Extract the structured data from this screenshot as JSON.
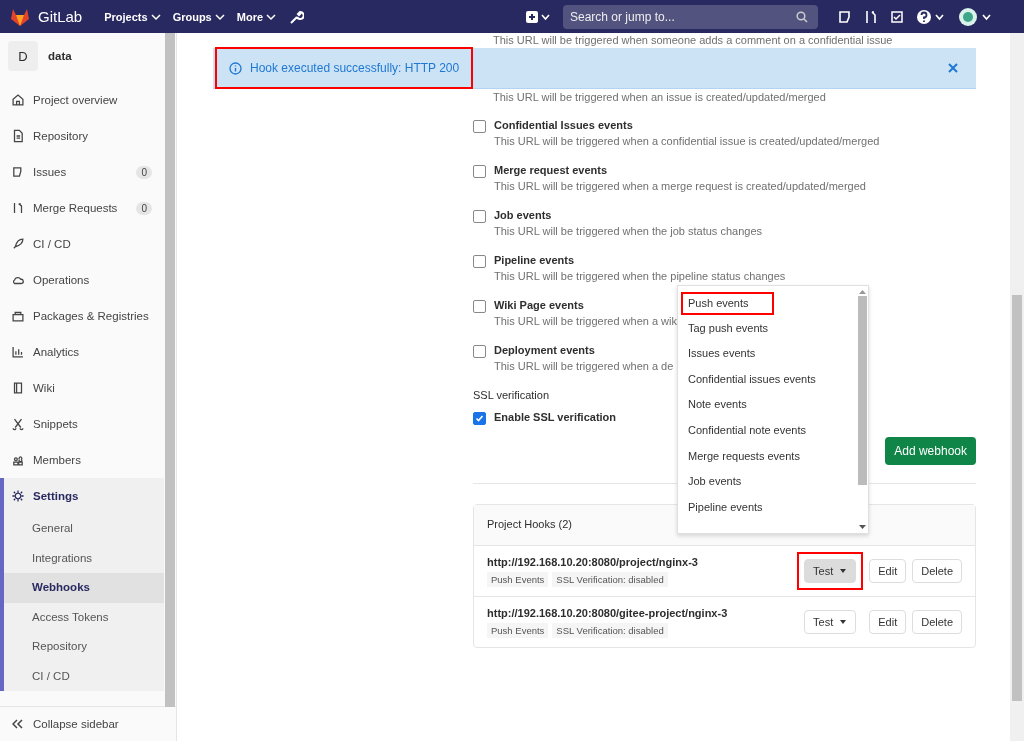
{
  "navbar": {
    "brand": "GitLab",
    "menus": [
      {
        "label": "Projects"
      },
      {
        "label": "Groups"
      },
      {
        "label": "More"
      }
    ],
    "search": {
      "placeholder": "Search or jump to..."
    }
  },
  "sidebar": {
    "project_initial": "D",
    "project_name": "data",
    "items": [
      {
        "label": "Project overview",
        "selected": false
      },
      {
        "label": "Repository",
        "selected": false
      },
      {
        "label": "Issues",
        "count": "0",
        "selected": false
      },
      {
        "label": "Merge Requests",
        "count": "0",
        "selected": false
      },
      {
        "label": "CI / CD",
        "selected": false
      },
      {
        "label": "Operations",
        "selected": false
      },
      {
        "label": "Packages & Registries",
        "selected": false
      },
      {
        "label": "Analytics",
        "selected": false
      },
      {
        "label": "Wiki",
        "selected": false
      },
      {
        "label": "Snippets",
        "selected": false
      },
      {
        "label": "Members",
        "selected": false
      },
      {
        "label": "Settings",
        "selected": true,
        "children": [
          {
            "label": "General",
            "selected": false
          },
          {
            "label": "Integrations",
            "selected": false
          },
          {
            "label": "Webhooks",
            "selected": true
          },
          {
            "label": "Access Tokens",
            "selected": false
          },
          {
            "label": "Repository",
            "selected": false
          },
          {
            "label": "CI / CD",
            "selected": false
          }
        ]
      }
    ],
    "collapse": "Collapse sidebar"
  },
  "alert": {
    "message": "Hook executed successfully: HTTP 200",
    "highlighted": true
  },
  "partial_descriptions": [
    "This URL will be triggered when someone adds a comment on a confidential issue",
    "This URL will be triggered when an issue is created/updated/merged"
  ],
  "events": [
    {
      "title": "Confidential Issues events",
      "description": "This URL will be triggered when a confidential issue is created/updated/merged",
      "checked": false
    },
    {
      "title": "Merge request events",
      "description": "This URL will be triggered when a merge request is created/updated/merged",
      "checked": false
    },
    {
      "title": "Job events",
      "description": "This URL will be triggered when the job status changes",
      "checked": false
    },
    {
      "title": "Pipeline events",
      "description": "This URL will be triggered when the pipeline status changes",
      "checked": false
    },
    {
      "title": "Wiki Page events",
      "description": "This URL will be triggered when a wik",
      "checked": false
    },
    {
      "title": "Deployment events",
      "description": "This URL will be triggered when a de",
      "checked": false
    }
  ],
  "ssl": {
    "heading": "SSL verification",
    "label": "Enable SSL verification",
    "checked": true
  },
  "add_button": "Add webhook",
  "hooks": {
    "title": "Project Hooks (2)",
    "rows": [
      {
        "url": "http://192.168.10.20:8080/project/nginx-3",
        "tags": [
          "Push Events",
          "SSL Verification: disabled"
        ],
        "test": "Test",
        "test_active": true,
        "highlighted": true,
        "edit": "Edit",
        "delete": "Delete"
      },
      {
        "url": "http://192.168.10.20:8080/gitee-project/nginx-3",
        "tags": [
          "Push Events",
          "SSL Verification: disabled"
        ],
        "test": "Test",
        "test_active": false,
        "highlighted": false,
        "edit": "Edit",
        "delete": "Delete"
      }
    ]
  },
  "test_menu": {
    "items": [
      {
        "label": "Push events",
        "highlighted": true
      },
      {
        "label": "Tag push events",
        "highlighted": false
      },
      {
        "label": "Issues events",
        "highlighted": false
      },
      {
        "label": "Confidential issues events",
        "highlighted": false
      },
      {
        "label": "Note events",
        "highlighted": false
      },
      {
        "label": "Confidential note events",
        "highlighted": false
      },
      {
        "label": "Merge requests events",
        "highlighted": false
      },
      {
        "label": "Job events",
        "highlighted": false
      },
      {
        "label": "Pipeline events",
        "highlighted": false
      }
    ]
  }
}
